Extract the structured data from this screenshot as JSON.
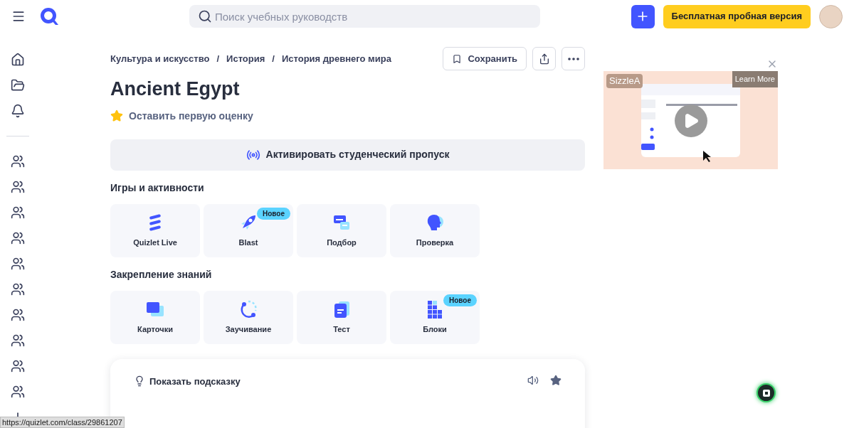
{
  "header": {
    "search": {
      "placeholder": "Поиск учебных руководств"
    },
    "trial_button": "Бесплатная пробная версия"
  },
  "sidebar": {
    "items": [
      {
        "kind": "home"
      },
      {
        "kind": "folder"
      },
      {
        "kind": "bell"
      },
      {
        "kind": "divider"
      },
      {
        "kind": "class"
      },
      {
        "kind": "class"
      },
      {
        "kind": "class"
      },
      {
        "kind": "class"
      },
      {
        "kind": "class"
      },
      {
        "kind": "class"
      },
      {
        "kind": "class"
      },
      {
        "kind": "class"
      },
      {
        "kind": "class"
      },
      {
        "kind": "class"
      },
      {
        "kind": "add"
      }
    ]
  },
  "breadcrumbs": [
    "Культура и искусство",
    "История",
    "История древнего мира"
  ],
  "breadcrumb_separator": "/",
  "save_button": "Сохранить",
  "title": "Ancient Egypt",
  "rating_prompt": "Оставить первую оценку",
  "pass_button": "Активировать студенческий пропуск",
  "sections": [
    {
      "title": "Игры и активности",
      "cards": [
        {
          "kind": "live",
          "label": "Quizlet Live"
        },
        {
          "kind": "blast",
          "label": "Blast",
          "badge": "Новое"
        },
        {
          "kind": "match",
          "label": "Подбор"
        },
        {
          "kind": "check",
          "label": "Проверка"
        }
      ]
    },
    {
      "title": "Закрепление знаний",
      "cards": [
        {
          "kind": "flashcards",
          "label": "Карточки"
        },
        {
          "kind": "learn",
          "label": "Заучивание"
        },
        {
          "kind": "test",
          "label": "Тест"
        },
        {
          "kind": "blocks",
          "label": "Блоки",
          "badge": "Новое"
        }
      ]
    }
  ],
  "flashcard": {
    "hint": "Показать подсказку"
  },
  "ad": {
    "brand": "SizzleA",
    "button": "Learn More"
  },
  "status_url": "https://quizlet.com/class/29861207"
}
